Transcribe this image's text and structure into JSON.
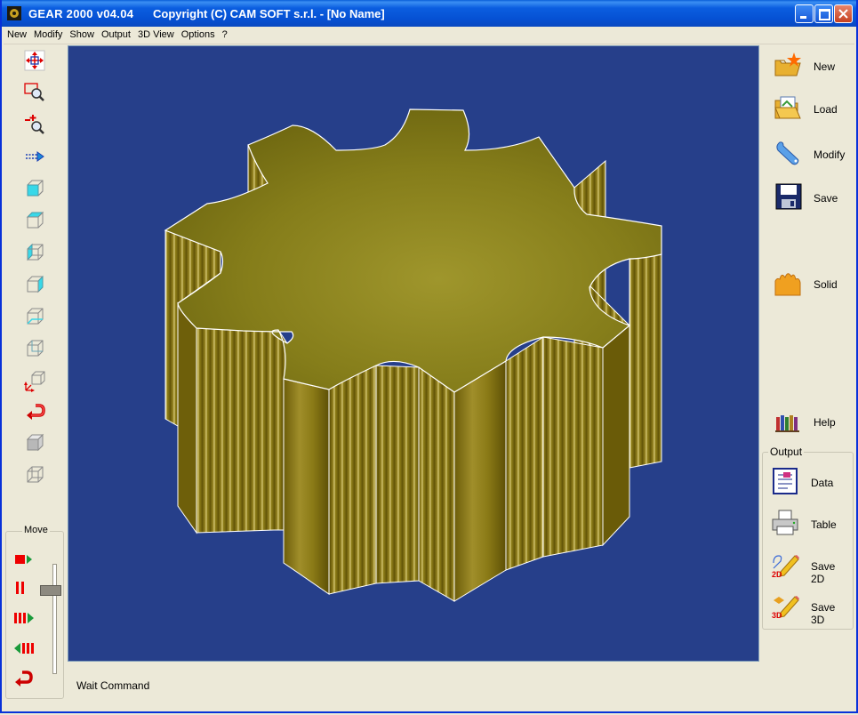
{
  "window": {
    "app_title": "GEAR 2000 v04.04",
    "copyright": "Copyright (C)  CAM SOFT s.r.l.  - [No Name]"
  },
  "menu": [
    "New",
    "Modify",
    "Show",
    "Output",
    "3D View",
    "Options",
    "?"
  ],
  "left_toolbar": [
    {
      "icon": "move-cross-icon"
    },
    {
      "icon": "zoom-window-icon"
    },
    {
      "icon": "zoom-in-out-icon"
    },
    {
      "icon": "pan-arrow-icon"
    },
    {
      "icon": "view-front-icon"
    },
    {
      "icon": "view-top-icon"
    },
    {
      "icon": "view-left-icon"
    },
    {
      "icon": "view-right-icon"
    },
    {
      "icon": "view-bottom-icon"
    },
    {
      "icon": "view-back-icon"
    },
    {
      "icon": "view-iso-icon"
    },
    {
      "icon": "rotate-back-icon"
    },
    {
      "icon": "render-solid-icon"
    },
    {
      "icon": "render-wireframe-icon"
    }
  ],
  "move": {
    "label": "Move",
    "buttons": [
      "stop-play-icon",
      "pause-icon",
      "step-forward-icon",
      "step-back-icon",
      "return-icon"
    ]
  },
  "right_panel": {
    "new": "New",
    "load": "Load",
    "modify": "Modify",
    "save": "Save",
    "solid": "Solid",
    "help": "Help"
  },
  "output": {
    "label": "Output",
    "data": "Data",
    "table": "Table",
    "save2d": "Save 2D",
    "save3d": "Save 3D",
    "badge_2d": "2D",
    "badge_3d": "3D"
  },
  "status": "Wait Command",
  "colors": {
    "viewport_bg": "#263f8a",
    "gear_top": "#7b7410",
    "gear_side": "#8a7a14"
  }
}
